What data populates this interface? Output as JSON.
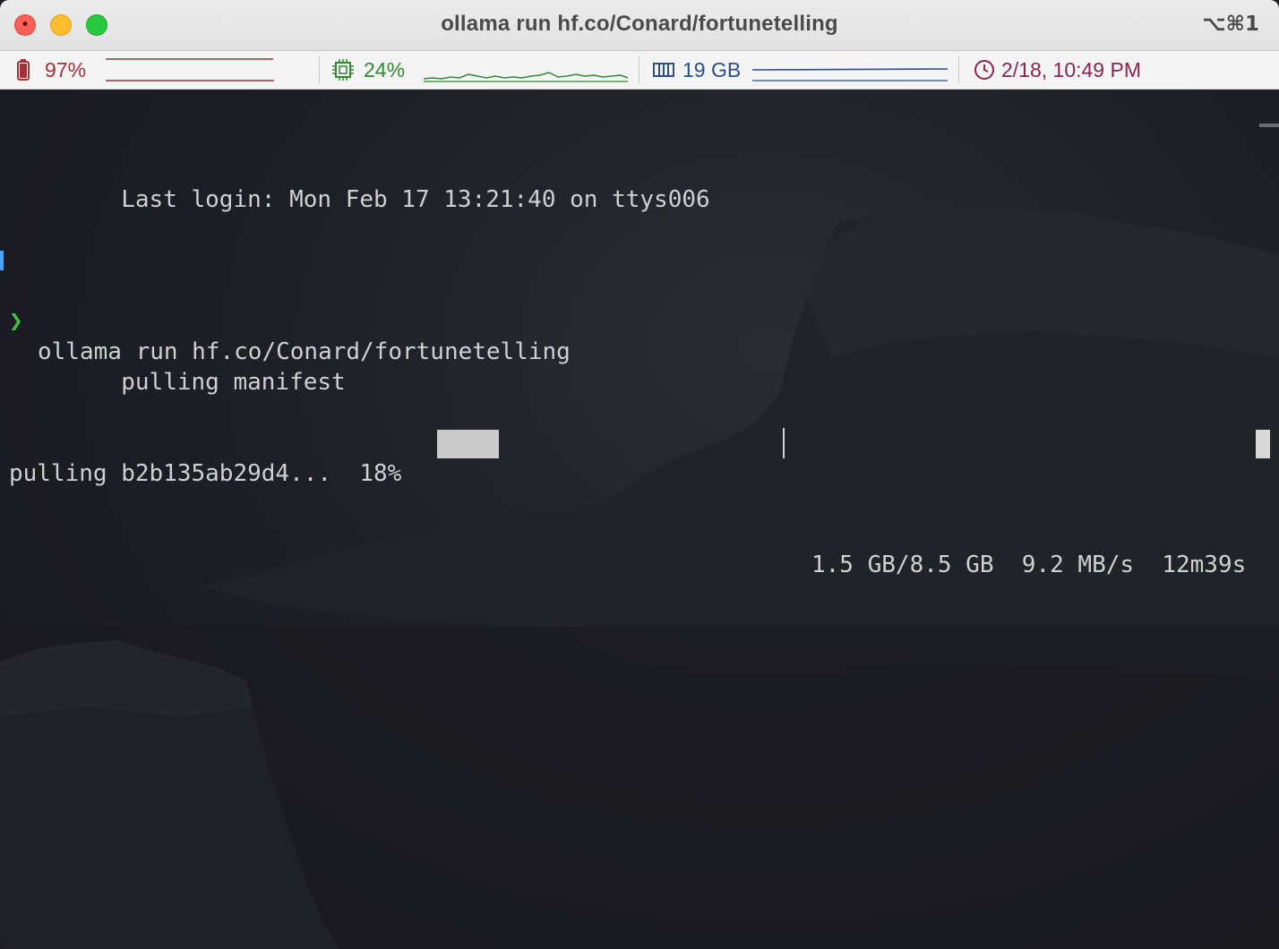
{
  "window": {
    "title": "ollama run hf.co/Conard/fortunetelling",
    "shortcut": "⌥⌘1"
  },
  "statusbar": {
    "battery": {
      "icon": "battery-icon",
      "value": "97%",
      "color": "#a0303a"
    },
    "cpu": {
      "icon": "cpu-chip-icon",
      "value": "24%",
      "color": "#2f8a2f"
    },
    "memory": {
      "icon": "memory-icon",
      "value": "19 GB",
      "color": "#2c4f86"
    },
    "clock": {
      "icon": "clock-icon",
      "value": "2/18, 10:49 PM",
      "color": "#8a2450"
    }
  },
  "terminal": {
    "last_login": "Last login: Mon Feb 17 13:21:40 on ttys006",
    "prompt_symbol": "❯",
    "command": "ollama run hf.co/Conard/fortunetelling",
    "pulling_manifest": "pulling manifest",
    "pull": {
      "prefix": "pulling b2b135ab29d4...  18%",
      "progress_fraction": 0.18,
      "stats": "1.5 GB/8.5 GB  9.2 MB/s  12m39s"
    }
  }
}
